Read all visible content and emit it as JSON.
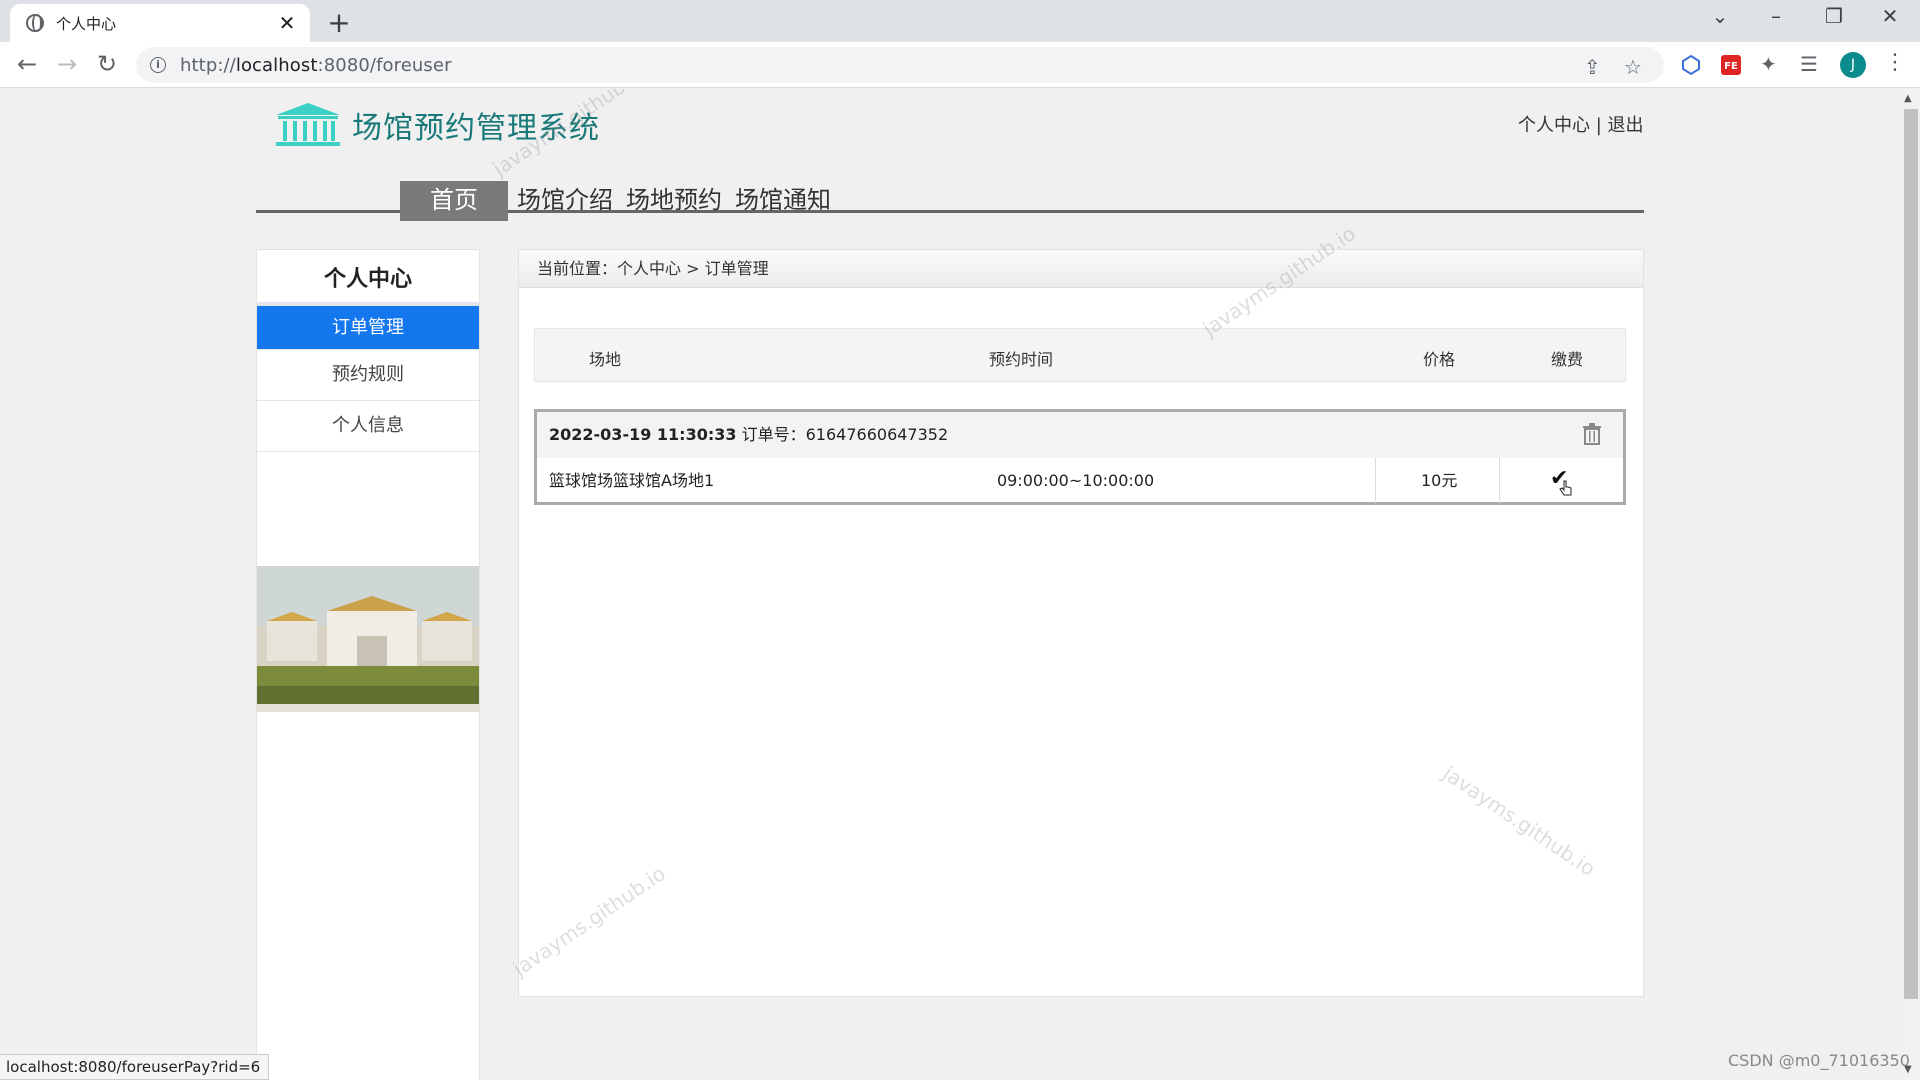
{
  "browser": {
    "tab_title": "个人中心",
    "tab_close": "✕",
    "new_tab": "+",
    "url_scheme": "http://",
    "url_host": "localhost",
    "url_path": ":8080/foreuser",
    "avatar_letter": "J",
    "status_url": "localhost:8080/foreuserPay?rid=6"
  },
  "header": {
    "system_name": "场馆预约管理系统",
    "user_center_link": "个人中心",
    "separator": " | ",
    "logout_link": "退出"
  },
  "nav": {
    "items": [
      {
        "label": "首页",
        "active": true
      },
      {
        "label": "场馆介绍",
        "active": false
      },
      {
        "label": "场地预约",
        "active": false
      },
      {
        "label": "场馆通知",
        "active": false
      }
    ]
  },
  "sidebar": {
    "title": "个人中心",
    "items": [
      {
        "label": "订单管理",
        "active": true
      },
      {
        "label": "预约规则",
        "active": false
      },
      {
        "label": "个人信息",
        "active": false
      }
    ]
  },
  "content": {
    "breadcrumb": "当前位置：个人中心 > 订单管理",
    "table_headers": {
      "venue": "场地",
      "time": "预约时间",
      "price": "价格",
      "pay": "缴费"
    },
    "order": {
      "datetime": "2022-03-19 11:30:33",
      "order_no_label": "订单号：",
      "order_no": "61647660647352",
      "venue": "篮球馆场篮球馆A场地1",
      "time_range": "09:00:00~10:00:00",
      "price": "10元"
    }
  },
  "watermark_text": "javayms.github.io",
  "footer_credit": "CSDN @m0_71016350",
  "colors": {
    "accent_blue": "#1477ee",
    "logo_teal": "#1a7a7a",
    "nav_active": "#7a7a7a"
  }
}
